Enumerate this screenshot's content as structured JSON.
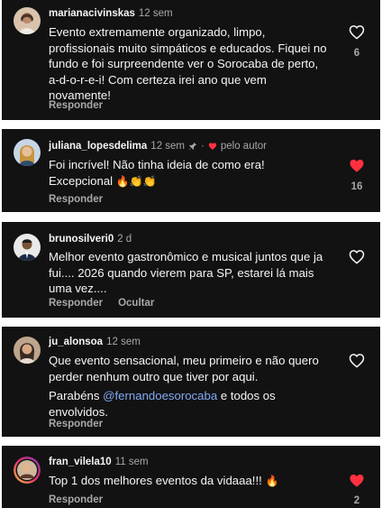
{
  "comments": [
    {
      "username": "marianacivinskas",
      "time": "12 sem",
      "text": "Evento extremamente organizado, limpo, profissionais muito simpáticos e educados. Fiquei no fundo e foi surpreendente ver o Sorocaba de perto, a-d-o-r-e-i! Com certeza irei ano que vem novamente!",
      "reply_label": "Responder",
      "liked": false,
      "likes": "6"
    },
    {
      "username": "juliana_lopesdelima",
      "time": "12 sem",
      "author_label": "pelo autor",
      "text_line1": "Foi incrível! Não tinha ideia de como era!",
      "text_line2": "Excepcional",
      "emojis": "🔥👏👏",
      "reply_label": "Responder",
      "liked": true,
      "likes": "16"
    },
    {
      "username": "brunosilveri0",
      "time": "2 d",
      "text": "Melhor evento gastronômico e musical juntos que ja fui.... 2026 quando vierem para SP, estarei lá mais uma vez....",
      "reply_label": "Responder",
      "hide_label": "Ocultar",
      "liked": false
    },
    {
      "username": "ju_alonsoa",
      "time": "12 sem",
      "text": "Que evento sensacional, meu primeiro e não quero perder nenhum outro que tiver por aqui.",
      "text2_prefix": "Parabéns ",
      "mention": "@fernandoesorocaba",
      "text2_suffix": " e todos os envolvidos.",
      "reply_label": "Responder",
      "liked": false
    },
    {
      "username": "fran_vilela10",
      "time": "11 sem",
      "text": "Top 1 dos melhores eventos da vidaaa!!!",
      "emojis": "🔥",
      "reply_label": "Responder",
      "liked": true,
      "likes": "2"
    }
  ],
  "colors": {
    "background": "#121212",
    "text": "#f5f5f5",
    "secondary": "#a8a8a8",
    "like_red": "#ff3040",
    "mention": "#82a9f5"
  }
}
